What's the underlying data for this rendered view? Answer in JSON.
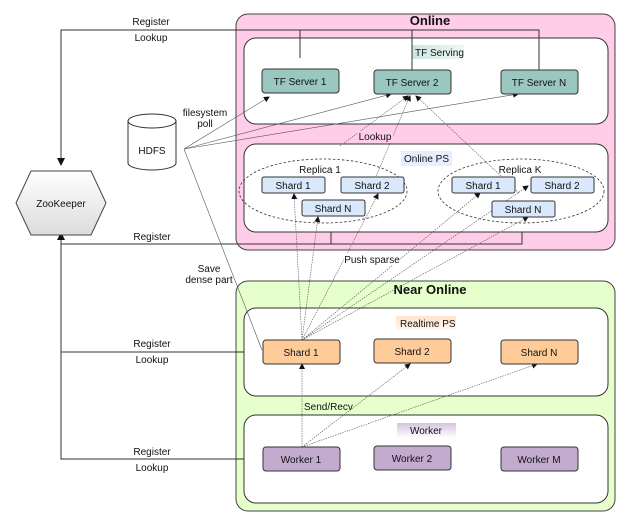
{
  "colors": {
    "online_bg": "#ffccea",
    "near_online_bg": "#e6ffcc",
    "tf_server": "#9ac7bf",
    "online_ps_shard": "#dae8fc",
    "realtime_shard": "#ffcc99",
    "worker": "#c3abd0",
    "zookeeper": "#eeeeee",
    "tf_serving_label_bg": "#cde6e1",
    "online_ps_label_bg": "#e4eefc",
    "realtime_ps_label_bg": "#ffe4cc",
    "worker_label_bg": "#dccde6"
  },
  "zookeeper": {
    "label": "ZooKeeper"
  },
  "hdfs": {
    "label": "HDFS"
  },
  "online": {
    "title": "Online",
    "tf_serving": {
      "label": "TF Serving",
      "servers": [
        "TF Server 1",
        "TF Server 2",
        "TF Server N"
      ]
    },
    "online_ps": {
      "label": "Online PS",
      "replicas": [
        {
          "label": "Replica 1",
          "shards": [
            "Shard 1",
            "Shard 2",
            "Shard N"
          ]
        },
        {
          "label": "Replica K",
          "shards": [
            "Shard 1",
            "Shard 2",
            "Shard N"
          ]
        }
      ]
    }
  },
  "near_online": {
    "title": "Near Online",
    "realtime_ps": {
      "label": "Realtime PS",
      "shards": [
        "Shard 1",
        "Shard 2",
        "Shard N"
      ]
    },
    "worker": {
      "label": "Worker",
      "workers": [
        "Worker 1",
        "Worker 2",
        "Worker M"
      ]
    }
  },
  "edge_labels": {
    "top_register": "Register",
    "top_lookup": "Lookup",
    "filesystem_poll": [
      "filesystem",
      "poll"
    ],
    "lookup": "Lookup",
    "online_ps_register": "Register",
    "push_sparse": "Push sparse",
    "save_dense": [
      "Save",
      "dense part"
    ],
    "realtime_register": "Register",
    "realtime_lookup": "Lookup",
    "send_recv": "Send/Recv",
    "worker_register": "Register",
    "worker_lookup": "Lookup"
  }
}
